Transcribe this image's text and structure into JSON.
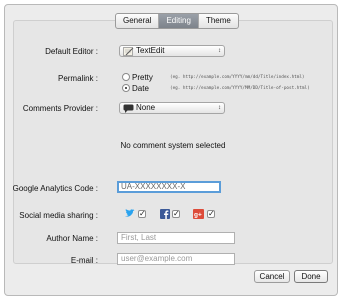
{
  "tabs": [
    {
      "label": "General",
      "active": false
    },
    {
      "label": "Editing",
      "active": true
    },
    {
      "label": "Theme",
      "active": false
    }
  ],
  "default_editor": {
    "label": "Default Editor :",
    "value": "TextEdit",
    "icon": "textedit-icon"
  },
  "permalink": {
    "label": "Permalink :",
    "options": [
      {
        "label": "Pretty",
        "selected": false,
        "example": "(eg. http://example.com/YYYY/mm/dd/Title/index.html)"
      },
      {
        "label": "Date",
        "selected": true,
        "example": "(eg. http://example.com/YYYY/MM/DD/Title-of-post.html)"
      }
    ]
  },
  "comments_provider": {
    "label": "Comments Provider :",
    "value": "None",
    "icon": "speech-bubble-icon"
  },
  "no_comment_message": "No comment system selected",
  "google_analytics": {
    "label": "Google Analytics Code :",
    "placeholder": "UA-XXXXXXXX-X"
  },
  "social_sharing": {
    "label": "Social media sharing :",
    "items": [
      {
        "name": "twitter",
        "icon": "twitter-bird-icon",
        "color": "#2aa3ef",
        "checked": true
      },
      {
        "name": "facebook",
        "icon": "facebook-icon",
        "color": "#3b5998",
        "checked": true
      },
      {
        "name": "google-plus",
        "icon": "google-plus-icon",
        "color": "#dd4b39",
        "checked": true
      }
    ]
  },
  "author_name": {
    "label": "Author Name :",
    "placeholder": "First, Last"
  },
  "email": {
    "label": "E-mail :",
    "placeholder": "user@example.com"
  },
  "buttons": {
    "cancel": "Cancel",
    "done": "Done"
  },
  "colors": {
    "focus_ring": "#5b9dd9",
    "active_tab": "#848a92"
  }
}
